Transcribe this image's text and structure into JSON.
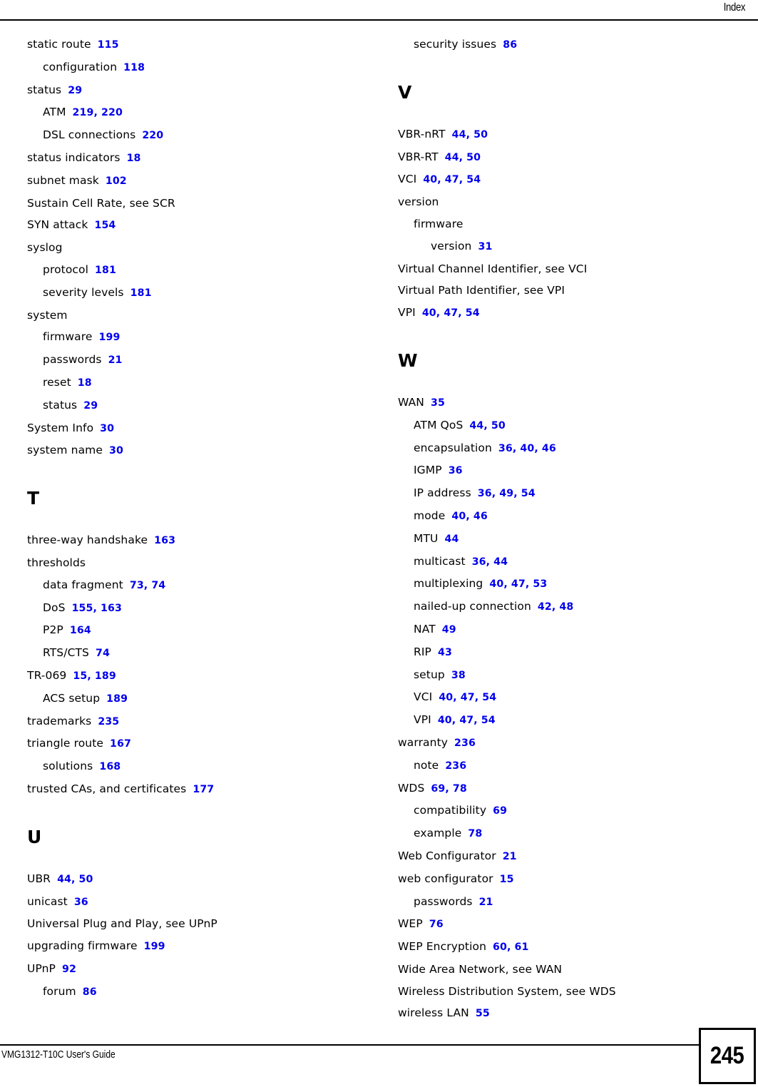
{
  "header": {
    "title": "Index"
  },
  "footer": {
    "guide_title": "VMG1312-T10C User's Guide",
    "page_number": "245"
  },
  "colors": {
    "reference_link": "#0000ee",
    "text": "#000000",
    "rule": "#000000"
  },
  "columns": [
    {
      "id": "left",
      "blocks": [
        {
          "type": "entries",
          "entries": [
            {
              "level": 0,
              "term": "static route",
              "refs": [
                "115"
              ]
            },
            {
              "level": 1,
              "term": "configuration",
              "refs": [
                "118"
              ]
            },
            {
              "level": 0,
              "term": "status",
              "refs": [
                "29"
              ]
            },
            {
              "level": 1,
              "term": "ATM",
              "refs": [
                "219",
                "220"
              ]
            },
            {
              "level": 1,
              "term": "DSL connections",
              "refs": [
                "220"
              ]
            },
            {
              "level": 0,
              "term": "status indicators",
              "refs": [
                "18"
              ]
            },
            {
              "level": 0,
              "term": "subnet mask",
              "refs": [
                "102"
              ]
            },
            {
              "level": 0,
              "term": "Sustain Cell Rate, see SCR",
              "refs": []
            },
            {
              "level": 0,
              "term": "SYN attack",
              "refs": [
                "154"
              ]
            },
            {
              "level": 0,
              "term": "syslog",
              "refs": []
            },
            {
              "level": 1,
              "term": "protocol",
              "refs": [
                "181"
              ]
            },
            {
              "level": 1,
              "term": "severity levels",
              "refs": [
                "181"
              ]
            },
            {
              "level": 0,
              "term": "system",
              "refs": []
            },
            {
              "level": 1,
              "term": "firmware",
              "refs": [
                "199"
              ]
            },
            {
              "level": 1,
              "term": "passwords",
              "refs": [
                "21"
              ]
            },
            {
              "level": 1,
              "term": "reset",
              "refs": [
                "18"
              ]
            },
            {
              "level": 1,
              "term": "status",
              "refs": [
                "29"
              ]
            },
            {
              "level": 0,
              "term": "System Info",
              "refs": [
                "30"
              ]
            },
            {
              "level": 0,
              "term": "system name",
              "refs": [
                "30"
              ]
            }
          ]
        },
        {
          "type": "letter",
          "letter": "T"
        },
        {
          "type": "entries",
          "entries": [
            {
              "level": 0,
              "term": "three-way handshake",
              "refs": [
                "163"
              ]
            },
            {
              "level": 0,
              "term": "thresholds",
              "refs": []
            },
            {
              "level": 1,
              "term": "data fragment",
              "refs": [
                "73",
                "74"
              ]
            },
            {
              "level": 1,
              "term": "DoS",
              "refs": [
                "155",
                "163"
              ]
            },
            {
              "level": 1,
              "term": "P2P",
              "refs": [
                "164"
              ]
            },
            {
              "level": 1,
              "term": "RTS/CTS",
              "refs": [
                "74"
              ]
            },
            {
              "level": 0,
              "term": "TR-069",
              "refs": [
                "15",
                "189"
              ]
            },
            {
              "level": 1,
              "term": "ACS setup",
              "refs": [
                "189"
              ]
            },
            {
              "level": 0,
              "term": "trademarks",
              "refs": [
                "235"
              ]
            },
            {
              "level": 0,
              "term": "triangle route",
              "refs": [
                "167"
              ]
            },
            {
              "level": 1,
              "term": "solutions",
              "refs": [
                "168"
              ]
            },
            {
              "level": 0,
              "term": "trusted CAs, and certificates",
              "refs": [
                "177"
              ]
            }
          ]
        },
        {
          "type": "letter",
          "letter": "U"
        },
        {
          "type": "entries",
          "entries": [
            {
              "level": 0,
              "term": "UBR",
              "refs": [
                "44",
                "50"
              ]
            },
            {
              "level": 0,
              "term": "unicast",
              "refs": [
                "36"
              ]
            },
            {
              "level": 0,
              "term": "Universal Plug and Play, see UPnP",
              "refs": []
            },
            {
              "level": 0,
              "term": "upgrading firmware",
              "refs": [
                "199"
              ]
            },
            {
              "level": 0,
              "term": "UPnP",
              "refs": [
                "92"
              ]
            },
            {
              "level": 1,
              "term": "forum",
              "refs": [
                "86"
              ]
            }
          ]
        }
      ]
    },
    {
      "id": "right",
      "blocks": [
        {
          "type": "entries",
          "entries": [
            {
              "level": 1,
              "term": "security issues",
              "refs": [
                "86"
              ]
            }
          ]
        },
        {
          "type": "letter",
          "letter": "V"
        },
        {
          "type": "entries",
          "entries": [
            {
              "level": 0,
              "term": "VBR-nRT",
              "refs": [
                "44",
                "50"
              ]
            },
            {
              "level": 0,
              "term": "VBR-RT",
              "refs": [
                "44",
                "50"
              ]
            },
            {
              "level": 0,
              "term": "VCI",
              "refs": [
                "40",
                "47",
                "54"
              ]
            },
            {
              "level": 0,
              "term": "version",
              "refs": []
            },
            {
              "level": 1,
              "term": "firmware",
              "refs": []
            },
            {
              "level": 2,
              "term": "version",
              "refs": [
                "31"
              ]
            },
            {
              "level": 0,
              "term": "Virtual Channel Identifier, see VCI",
              "refs": []
            },
            {
              "level": 0,
              "term": "Virtual Path Identifier, see VPI",
              "refs": []
            },
            {
              "level": 0,
              "term": "VPI",
              "refs": [
                "40",
                "47",
                "54"
              ]
            }
          ]
        },
        {
          "type": "letter",
          "letter": "W"
        },
        {
          "type": "entries",
          "entries": [
            {
              "level": 0,
              "term": "WAN",
              "refs": [
                "35"
              ]
            },
            {
              "level": 1,
              "term": "ATM QoS",
              "refs": [
                "44",
                "50"
              ]
            },
            {
              "level": 1,
              "term": "encapsulation",
              "refs": [
                "36",
                "40",
                "46"
              ]
            },
            {
              "level": 1,
              "term": "IGMP",
              "refs": [
                "36"
              ]
            },
            {
              "level": 1,
              "term": "IP address",
              "refs": [
                "36",
                "49",
                "54"
              ]
            },
            {
              "level": 1,
              "term": "mode",
              "refs": [
                "40",
                "46"
              ]
            },
            {
              "level": 1,
              "term": "MTU",
              "refs": [
                "44"
              ]
            },
            {
              "level": 1,
              "term": "multicast",
              "refs": [
                "36",
                "44"
              ]
            },
            {
              "level": 1,
              "term": "multiplexing",
              "refs": [
                "40",
                "47",
                "53"
              ]
            },
            {
              "level": 1,
              "term": "nailed-up connection",
              "refs": [
                "42",
                "48"
              ]
            },
            {
              "level": 1,
              "term": "NAT",
              "refs": [
                "49"
              ]
            },
            {
              "level": 1,
              "term": "RIP",
              "refs": [
                "43"
              ]
            },
            {
              "level": 1,
              "term": "setup",
              "refs": [
                "38"
              ]
            },
            {
              "level": 1,
              "term": "VCI",
              "refs": [
                "40",
                "47",
                "54"
              ]
            },
            {
              "level": 1,
              "term": "VPI",
              "refs": [
                "40",
                "47",
                "54"
              ]
            },
            {
              "level": 0,
              "term": "warranty",
              "refs": [
                "236"
              ]
            },
            {
              "level": 1,
              "term": "note",
              "refs": [
                "236"
              ]
            },
            {
              "level": 0,
              "term": "WDS",
              "refs": [
                "69",
                "78"
              ]
            },
            {
              "level": 1,
              "term": "compatibility",
              "refs": [
                "69"
              ]
            },
            {
              "level": 1,
              "term": "example",
              "refs": [
                "78"
              ]
            },
            {
              "level": 0,
              "term": "Web Configurator",
              "refs": [
                "21"
              ]
            },
            {
              "level": 0,
              "term": "web configurator",
              "refs": [
                "15"
              ]
            },
            {
              "level": 1,
              "term": "passwords",
              "refs": [
                "21"
              ]
            },
            {
              "level": 0,
              "term": "WEP",
              "refs": [
                "76"
              ]
            },
            {
              "level": 0,
              "term": "WEP Encryption",
              "refs": [
                "60",
                "61"
              ]
            },
            {
              "level": 0,
              "term": "Wide Area Network, see WAN",
              "refs": []
            },
            {
              "level": 0,
              "term": "Wireless Distribution System, see WDS",
              "refs": []
            },
            {
              "level": 0,
              "term": "wireless LAN",
              "refs": [
                "55"
              ]
            }
          ]
        }
      ]
    }
  ]
}
